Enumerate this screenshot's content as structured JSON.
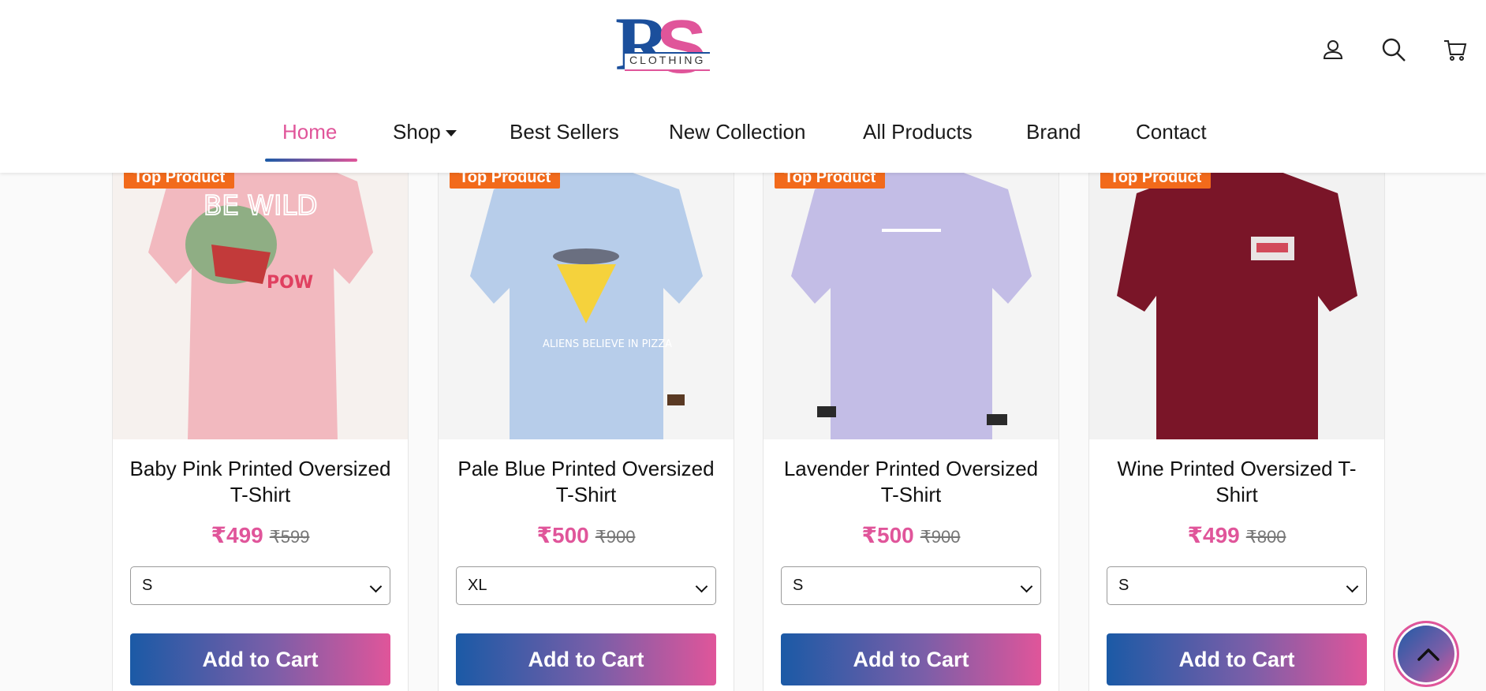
{
  "brand": {
    "letters_1": "R",
    "letters_2": "S",
    "word": "CLOTHING"
  },
  "colors": {
    "brand_blue": "#1b5aa6",
    "brand_pink": "#e0559a",
    "badge_orange": "#f26a1b"
  },
  "header_icons": [
    "user-icon",
    "search-icon",
    "cart-icon"
  ],
  "nav": {
    "home": "Home",
    "shop": "Shop",
    "best_sellers": "Best Sellers",
    "new_collection": "New Collection",
    "all_products": "All Products",
    "brand": "Brand",
    "contact": "Contact"
  },
  "products": [
    {
      "badge": "Top Product",
      "title_1": "Baby Pink Printed Oversized",
      "title_2": "T-Shirt",
      "price": "₹499",
      "old_price": "₹599",
      "size": "S",
      "button": "Add to Cart"
    },
    {
      "badge": "Top Product",
      "title_1": "Pale Blue Printed Oversized",
      "title_2": "T-Shirt",
      "price": "₹500",
      "old_price": "₹900",
      "size": "XL",
      "button": "Add to Cart"
    },
    {
      "badge": "Top Product",
      "title_1": "Lavender Printed Oversized",
      "title_2": "T-Shirt",
      "price": "₹500",
      "old_price": "₹900",
      "size": "S",
      "button": "Add to Cart"
    },
    {
      "badge": "Top Product",
      "title_1": "Wine Printed Oversized T-",
      "title_2": "Shirt",
      "price": "₹499",
      "old_price": "₹800",
      "size": "S",
      "button": "Add to Cart"
    }
  ]
}
